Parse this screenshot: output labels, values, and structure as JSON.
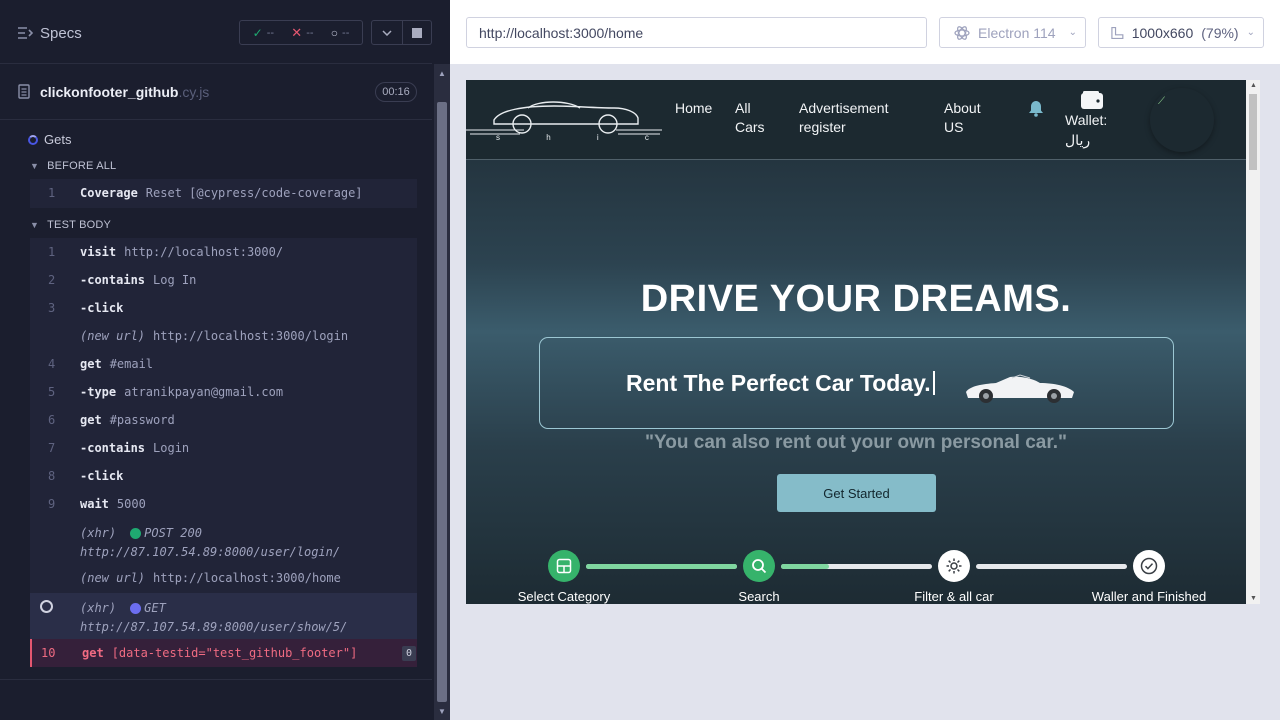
{
  "runner": {
    "specs_label": "Specs",
    "stats": {
      "passed": "--",
      "failed": "--",
      "pending": "--"
    },
    "file": {
      "name": "clickonfooter_github",
      "ext": ".cy.js",
      "duration": "00:16"
    },
    "suite_title": "Gets",
    "before_all": {
      "heading": "BEFORE ALL",
      "commands": [
        {
          "num": "1",
          "name": "Coverage",
          "message": "Reset [@cypress/code-coverage]"
        }
      ]
    },
    "test_body": {
      "heading": "TEST BODY",
      "commands": [
        {
          "num": "1",
          "name": "visit",
          "message": "http://localhost:3000/"
        },
        {
          "num": "2",
          "name": "-contains",
          "message": "Log In"
        },
        {
          "num": "3",
          "name": "-click",
          "message": ""
        },
        {
          "num": "",
          "name": "(new url)",
          "message": "http://localhost:3000/login"
        },
        {
          "num": "4",
          "name": "get",
          "message": "#email"
        },
        {
          "num": "5",
          "name": "-type",
          "message": "atranikpayan@gmail.com"
        },
        {
          "num": "6",
          "name": "get",
          "message": "#password"
        },
        {
          "num": "7",
          "name": "-contains",
          "message": "Login"
        },
        {
          "num": "8",
          "name": "-click",
          "message": ""
        },
        {
          "num": "9",
          "name": "wait",
          "message": "5000"
        }
      ],
      "xhr_done": {
        "label": "(xhr)",
        "method": "POST 200",
        "url": "http://87.107.54.89:8000/user/login/"
      },
      "new_url": {
        "label": "(new url)",
        "url": "http://localhost:3000/home"
      },
      "xhr_pending": {
        "label": "(xhr)",
        "method": "GET",
        "url": "http://87.107.54.89:8000/user/show/5/"
      },
      "failed": {
        "num": "10",
        "name": "get",
        "message": "[data-testid=\"test_github_footer\"]",
        "count": "0"
      }
    }
  },
  "browser": {
    "url": "http://localhost:3000/home",
    "browser_name": "Electron 114",
    "viewport": "1000x660",
    "zoom": "(79%)"
  },
  "app": {
    "logo_text": "s h i c h i",
    "nav": {
      "home": "Home",
      "cars": "All Cars",
      "advertisement": "Advertisement register",
      "about": "About US",
      "wallet": "Wallet: ریال"
    },
    "hero_title": "DRIVE YOUR DREAMS.",
    "hero_subtitle": "Rent The Perfect Car Today.",
    "quote": "\"You can also rent out your own personal car.\"",
    "cta": "Get Started",
    "steps": [
      {
        "label": "Select Category",
        "state": "done",
        "icon": "category-icon"
      },
      {
        "label": "Search",
        "state": "done",
        "icon": "search-icon"
      },
      {
        "label": "Filter & all car",
        "state": "todo",
        "icon": "gear-icon"
      },
      {
        "label": "Waller and Finished",
        "state": "todo",
        "icon": "check-circle-icon"
      }
    ],
    "progress": [
      1.0,
      0.32,
      0.0
    ],
    "colors": {
      "accent": "#36b36b",
      "track_fill": "#7fd6a0",
      "cta_bg": "#85bcc9"
    }
  }
}
